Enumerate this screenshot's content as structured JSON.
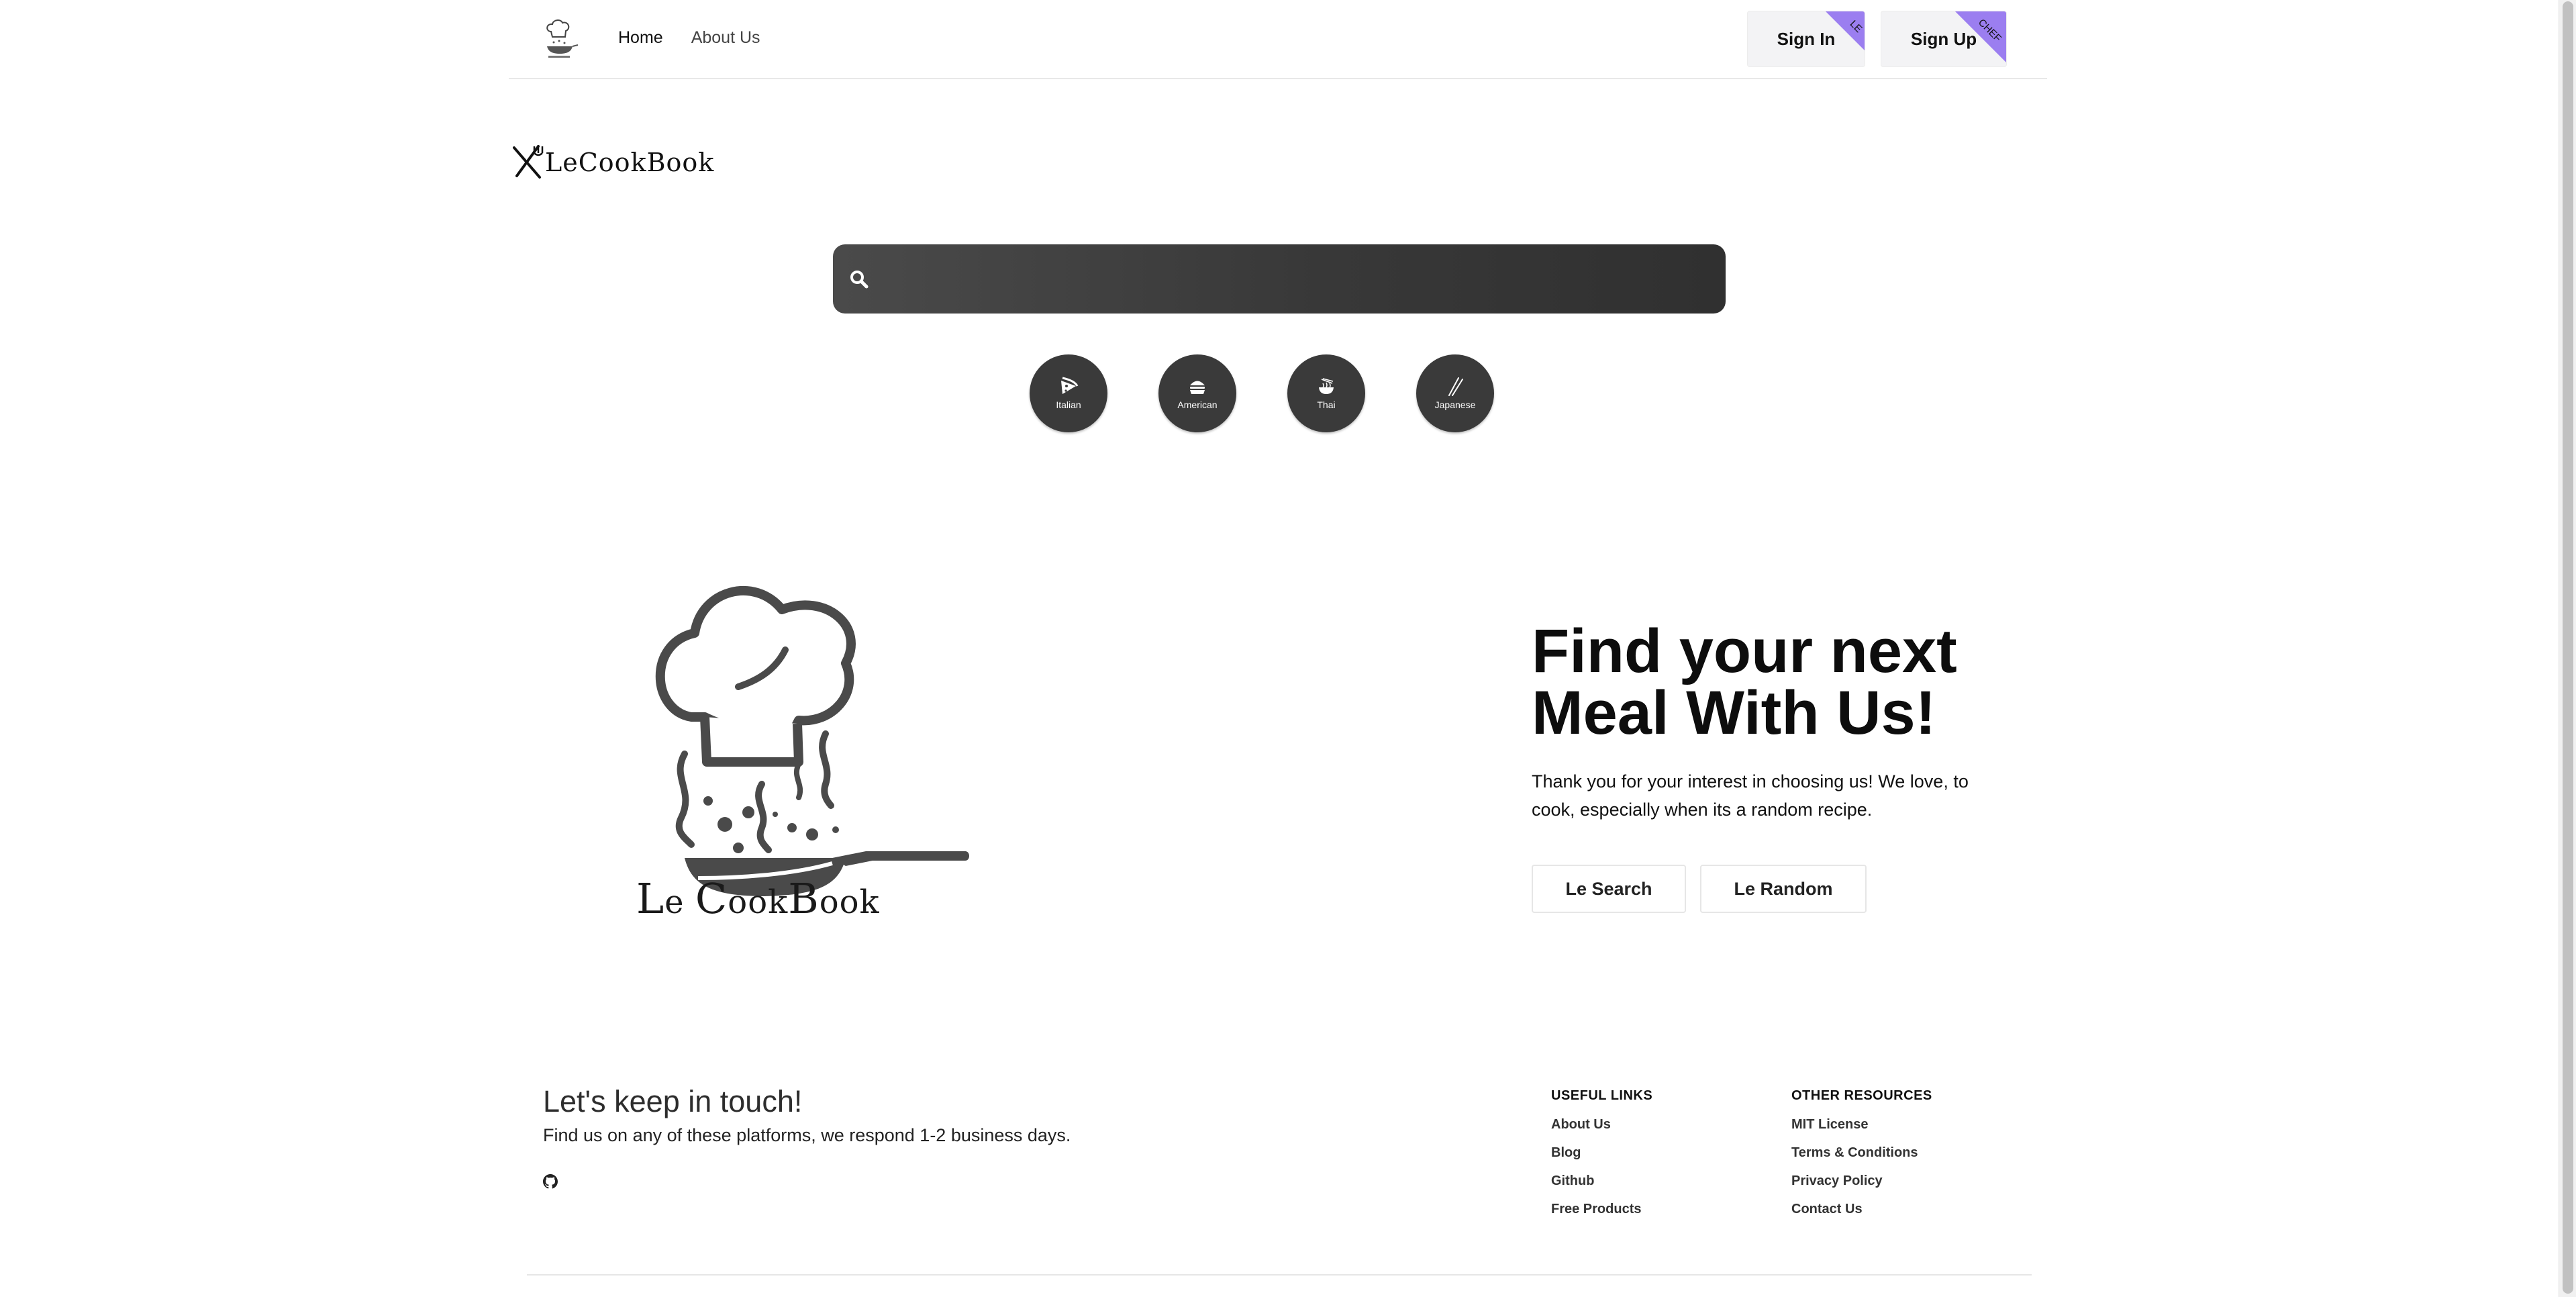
{
  "nav": {
    "links": [
      {
        "label": "Home"
      },
      {
        "label": "About Us"
      }
    ],
    "sign_in": {
      "label": "Sign In",
      "ribbon": "LE"
    },
    "sign_up": {
      "label": "Sign Up",
      "ribbon": "CHEF"
    }
  },
  "brand": {
    "name": "LeCookBook"
  },
  "search": {
    "placeholder": "",
    "value": ""
  },
  "cuisines": [
    {
      "label": "Italian",
      "icon": "pizza-icon"
    },
    {
      "label": "American",
      "icon": "burger-icon"
    },
    {
      "label": "Thai",
      "icon": "noodle-bowl-icon"
    },
    {
      "label": "Japanese",
      "icon": "chopsticks-icon"
    }
  ],
  "hero": {
    "logo_text_first": "L",
    "logo_text_le_rest": "e ",
    "logo_text_c": "C",
    "logo_text_ook": "ook",
    "logo_text_b": "B",
    "logo_text_ook2": "ook",
    "title": "Find your next\nMeal  With Us!",
    "description": "Thank you for your interest in choosing us! We love, to cook, especially when its a random recipe.",
    "search_button": "Le Search",
    "random_button": "Le Random"
  },
  "footer": {
    "title": "Let's keep in touch!",
    "subtitle": "Find us on any of these platforms, we respond 1-2 business days.",
    "useful_links": {
      "heading": "USEFUL LINKS",
      "items": [
        "About Us",
        "Blog",
        "Github",
        "Free Products"
      ]
    },
    "other_resources": {
      "heading": "OTHER RESOURCES",
      "items": [
        "MIT License",
        "Terms & Conditions",
        "Privacy Policy",
        "Contact Us"
      ]
    }
  },
  "colors": {
    "ribbon": "#9b7ef0",
    "search_bg": "#3a3a3a",
    "cuisine_bg": "#3a3a3a",
    "logo_gray": "#4a4a4a"
  }
}
